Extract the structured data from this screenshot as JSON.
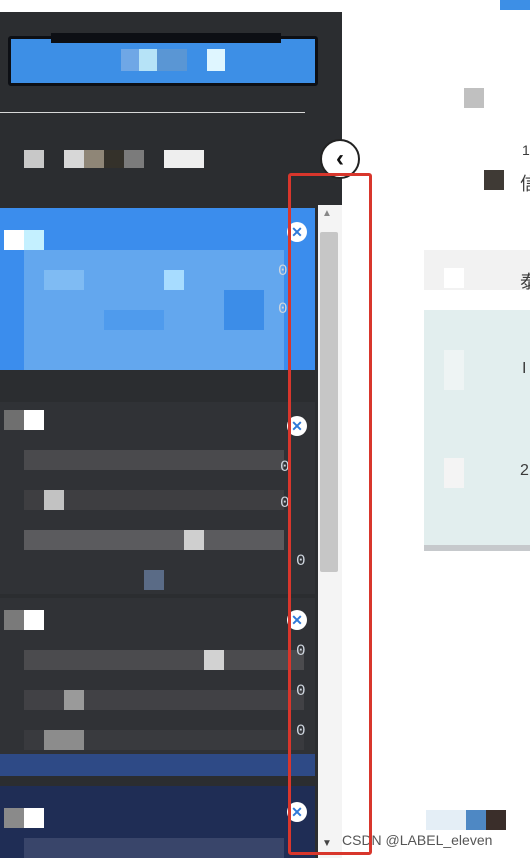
{
  "sidebar": {
    "collapse_icon": "chevron-left-icon",
    "cards": [
      {
        "status": "active",
        "close_icon": "close-circle-icon",
        "digits": [
          "0",
          "0"
        ]
      },
      {
        "status": "inactive",
        "close_icon": "close-circle-icon",
        "digits": [
          "0",
          "0",
          "0"
        ]
      },
      {
        "status": "inactive",
        "close_icon": "close-circle-icon",
        "digits": [
          "0",
          "0",
          "0"
        ]
      },
      {
        "status": "inactive",
        "close_icon": "close-circle-icon",
        "digits": []
      }
    ],
    "scrollbar": {
      "up_icon": "scroll-up-icon",
      "down_icon": "scroll-down-icon"
    }
  },
  "main": {
    "fragments": [
      "信",
      "1",
      "泰",
      "I",
      "2"
    ]
  },
  "watermark": "CSDN @LABEL_eleven",
  "colors": {
    "sidebar_bg": "#2b2d30",
    "active_card": "#3b8ded",
    "highlight_box": "#d8362c",
    "close_icon": "#2f79d8"
  }
}
